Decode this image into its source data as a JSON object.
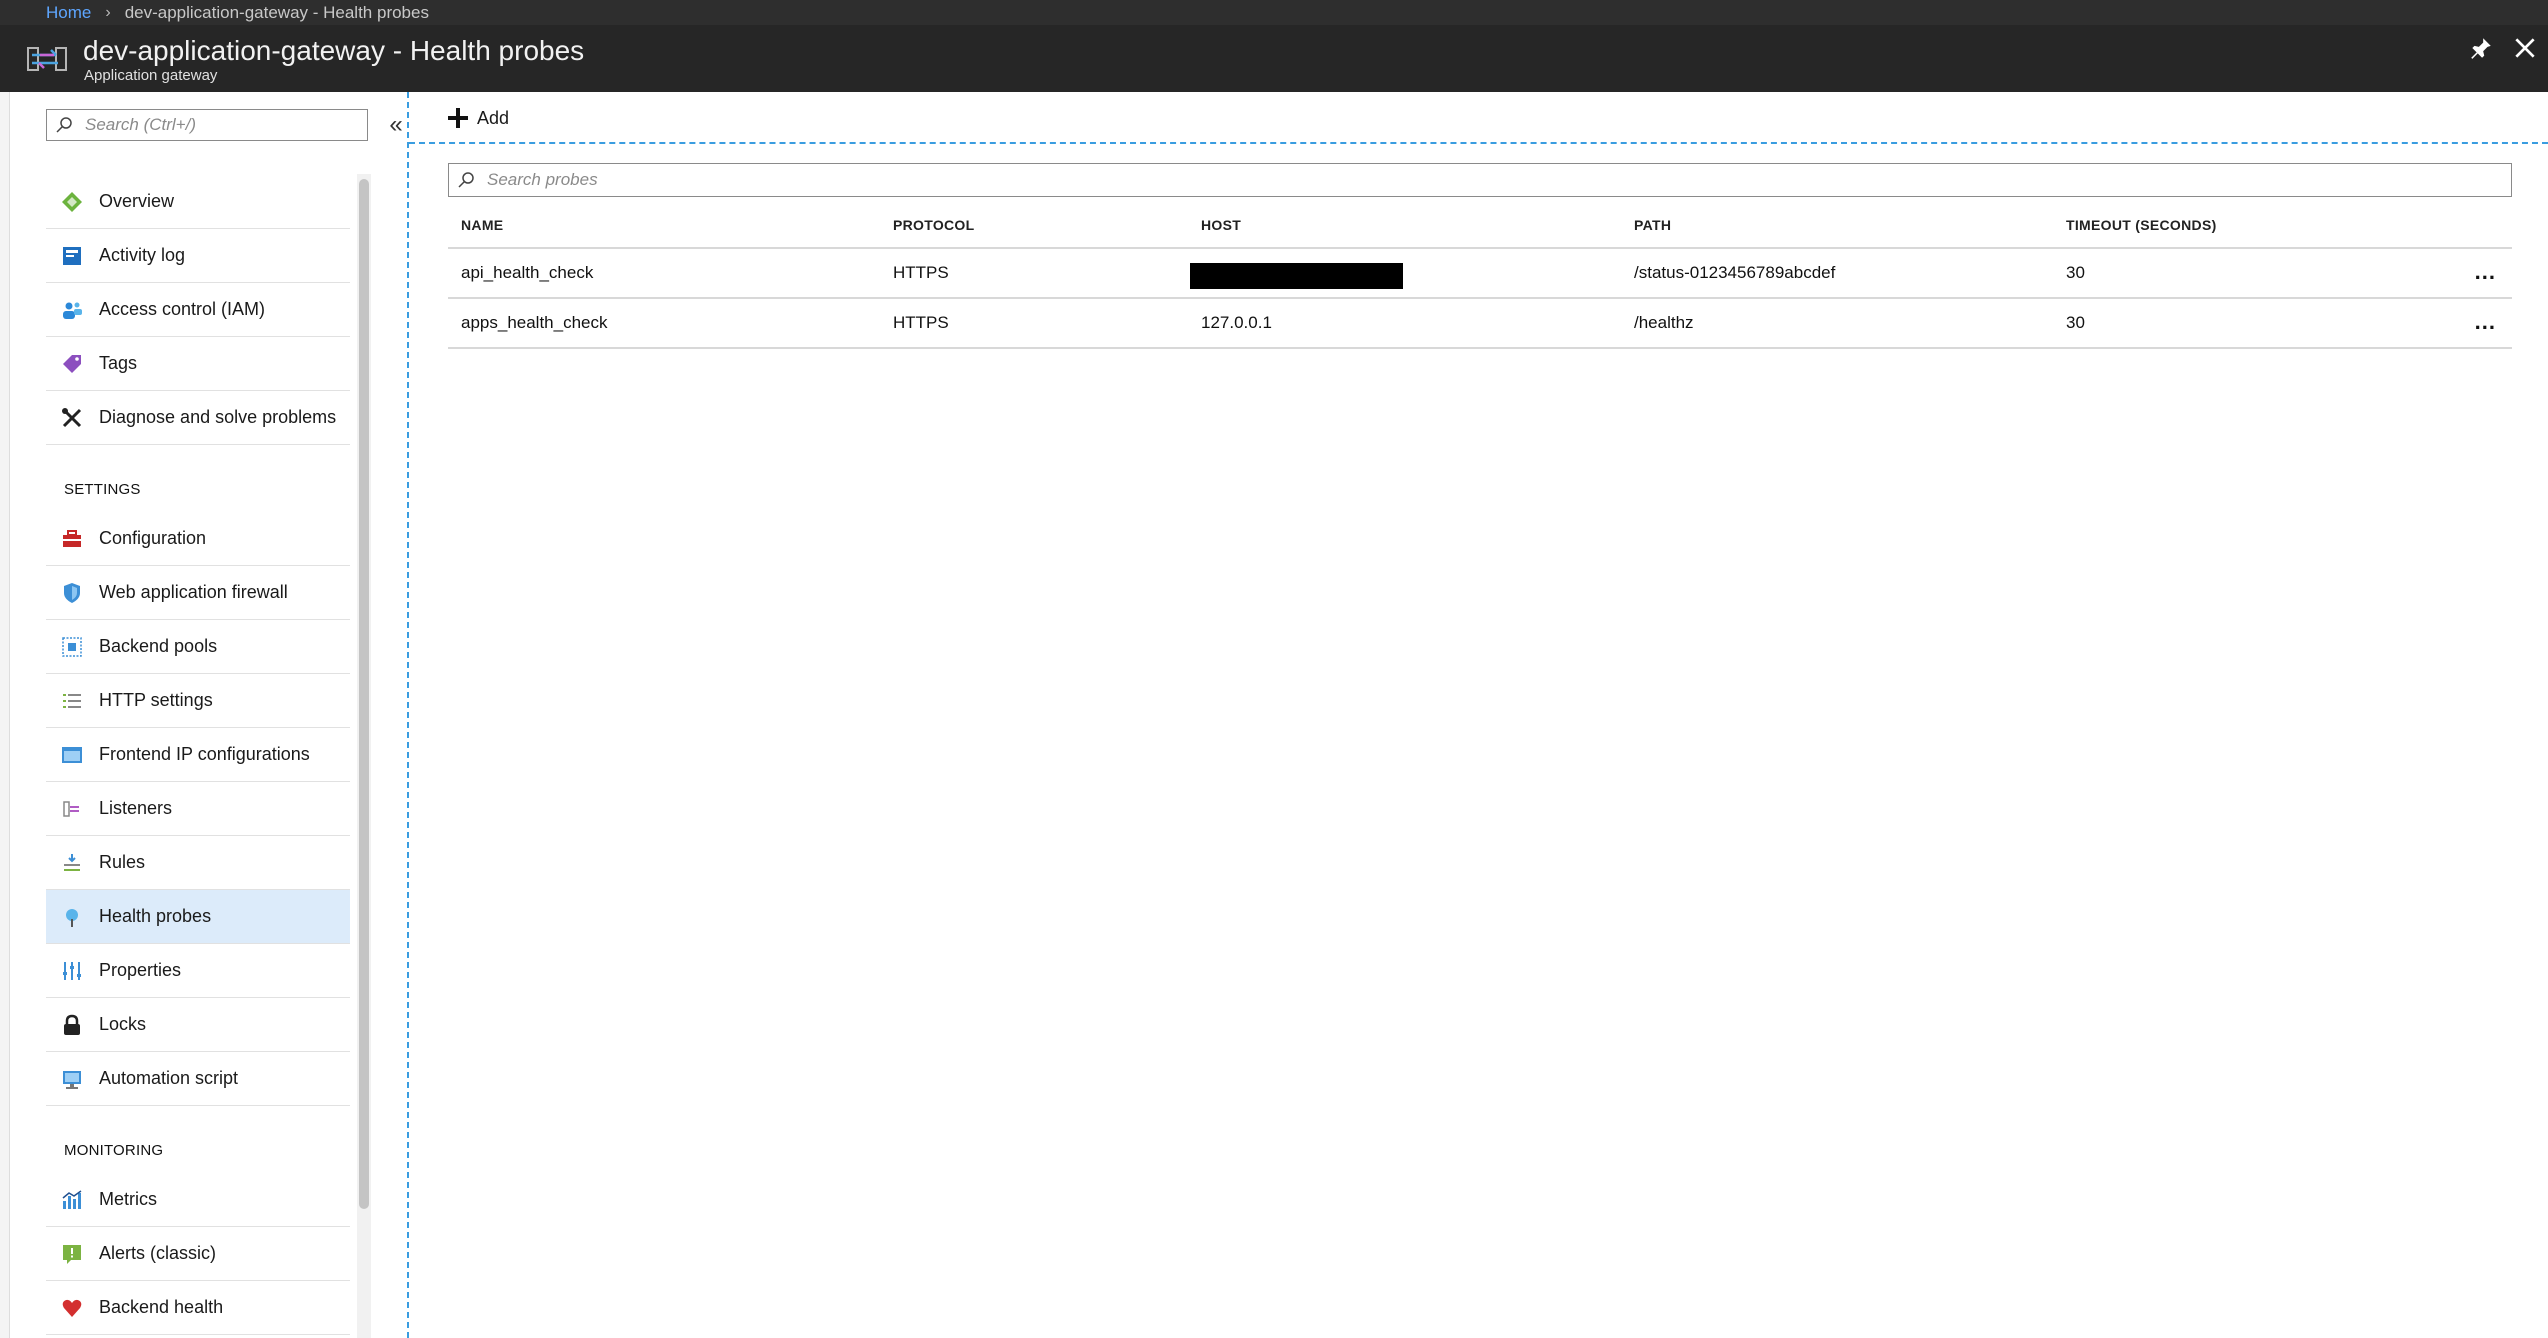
{
  "breadcrumb": {
    "home": "Home",
    "current": "dev-application-gateway - Health probes"
  },
  "header": {
    "title": "dev-application-gateway - Health probes",
    "subtitle": "Application gateway"
  },
  "sidebar": {
    "search_placeholder": "Search (Ctrl+/)",
    "collapse_glyph": "«",
    "top_items": [
      {
        "label": "Overview",
        "icon": "overview-icon"
      },
      {
        "label": "Activity log",
        "icon": "activity-log-icon"
      },
      {
        "label": "Access control (IAM)",
        "icon": "access-control-icon"
      },
      {
        "label": "Tags",
        "icon": "tag-icon"
      },
      {
        "label": "Diagnose and solve problems",
        "icon": "wrench-icon"
      }
    ],
    "settings_header": "SETTINGS",
    "settings_items": [
      {
        "label": "Configuration",
        "icon": "toolbox-icon"
      },
      {
        "label": "Web application firewall",
        "icon": "shield-icon"
      },
      {
        "label": "Backend pools",
        "icon": "backend-pool-icon"
      },
      {
        "label": "HTTP settings",
        "icon": "list-icon"
      },
      {
        "label": "Frontend IP configurations",
        "icon": "frontend-ip-icon"
      },
      {
        "label": "Listeners",
        "icon": "listener-icon"
      },
      {
        "label": "Rules",
        "icon": "rules-icon"
      },
      {
        "label": "Health probes",
        "icon": "health-probe-icon",
        "active": true
      },
      {
        "label": "Properties",
        "icon": "properties-icon"
      },
      {
        "label": "Locks",
        "icon": "lock-icon"
      },
      {
        "label": "Automation script",
        "icon": "automation-script-icon"
      }
    ],
    "monitoring_header": "MONITORING",
    "monitoring_items": [
      {
        "label": "Metrics",
        "icon": "metrics-icon"
      },
      {
        "label": "Alerts (classic)",
        "icon": "alert-icon"
      },
      {
        "label": "Backend health",
        "icon": "heart-icon"
      }
    ]
  },
  "toolbar": {
    "add_label": "Add"
  },
  "probes": {
    "search_placeholder": "Search probes",
    "columns": [
      "NAME",
      "PROTOCOL",
      "HOST",
      "PATH",
      "TIMEOUT (SECONDS)"
    ],
    "rows": [
      {
        "name": "api_health_check",
        "protocol": "HTTPS",
        "host": "",
        "host_redacted": true,
        "path": "/status-0123456789abcdef",
        "timeout": "30"
      },
      {
        "name": "apps_health_check",
        "protocol": "HTTPS",
        "host": "127.0.0.1",
        "host_redacted": false,
        "path": "/healthz",
        "timeout": "30"
      }
    ],
    "more_glyph": "..."
  },
  "colors": {
    "accent": "#3a9de0",
    "header_bg": "#262626",
    "active_item_bg": "#dcebfa",
    "link": "#5ea6ff"
  }
}
